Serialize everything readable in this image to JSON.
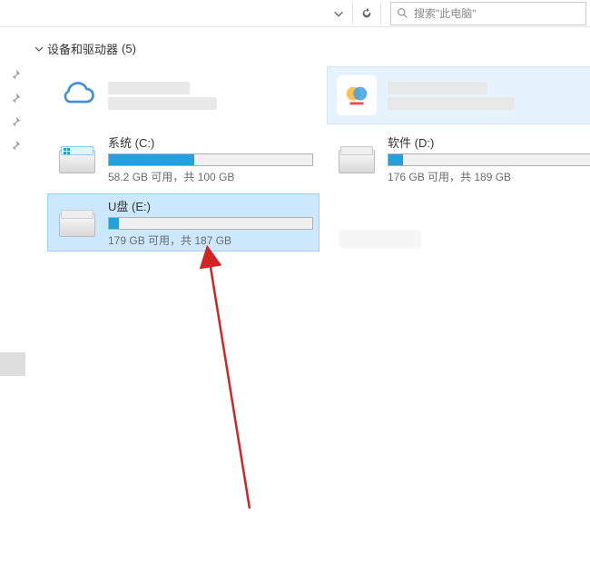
{
  "search": {
    "placeholder": "搜索\"此电脑\""
  },
  "section": {
    "title": "设备和驱动器",
    "count": "(5)"
  },
  "drives": [
    {
      "kind": "cloud",
      "label": "",
      "status": "",
      "selected": false,
      "blurred": true
    },
    {
      "kind": "app",
      "label": "",
      "status": "",
      "selected": false,
      "blurred": true,
      "hover": true
    },
    {
      "kind": "disk-os",
      "label": "系统 (C:)",
      "status": "58.2 GB 可用，共 100 GB",
      "fill_pct": 42,
      "selected": false
    },
    {
      "kind": "disk",
      "label": "软件 (D:)",
      "status": "176 GB 可用，共 189 GB",
      "fill_pct": 7,
      "selected": false
    },
    {
      "kind": "disk",
      "label": "U盘 (E:)",
      "status": "179 GB 可用，共 187 GB",
      "fill_pct": 5,
      "selected": true
    }
  ],
  "colors": {
    "accent": "#26a0da",
    "select_bg": "#cce8ff",
    "select_border": "#99d1ff",
    "arrow": "#d22424"
  }
}
